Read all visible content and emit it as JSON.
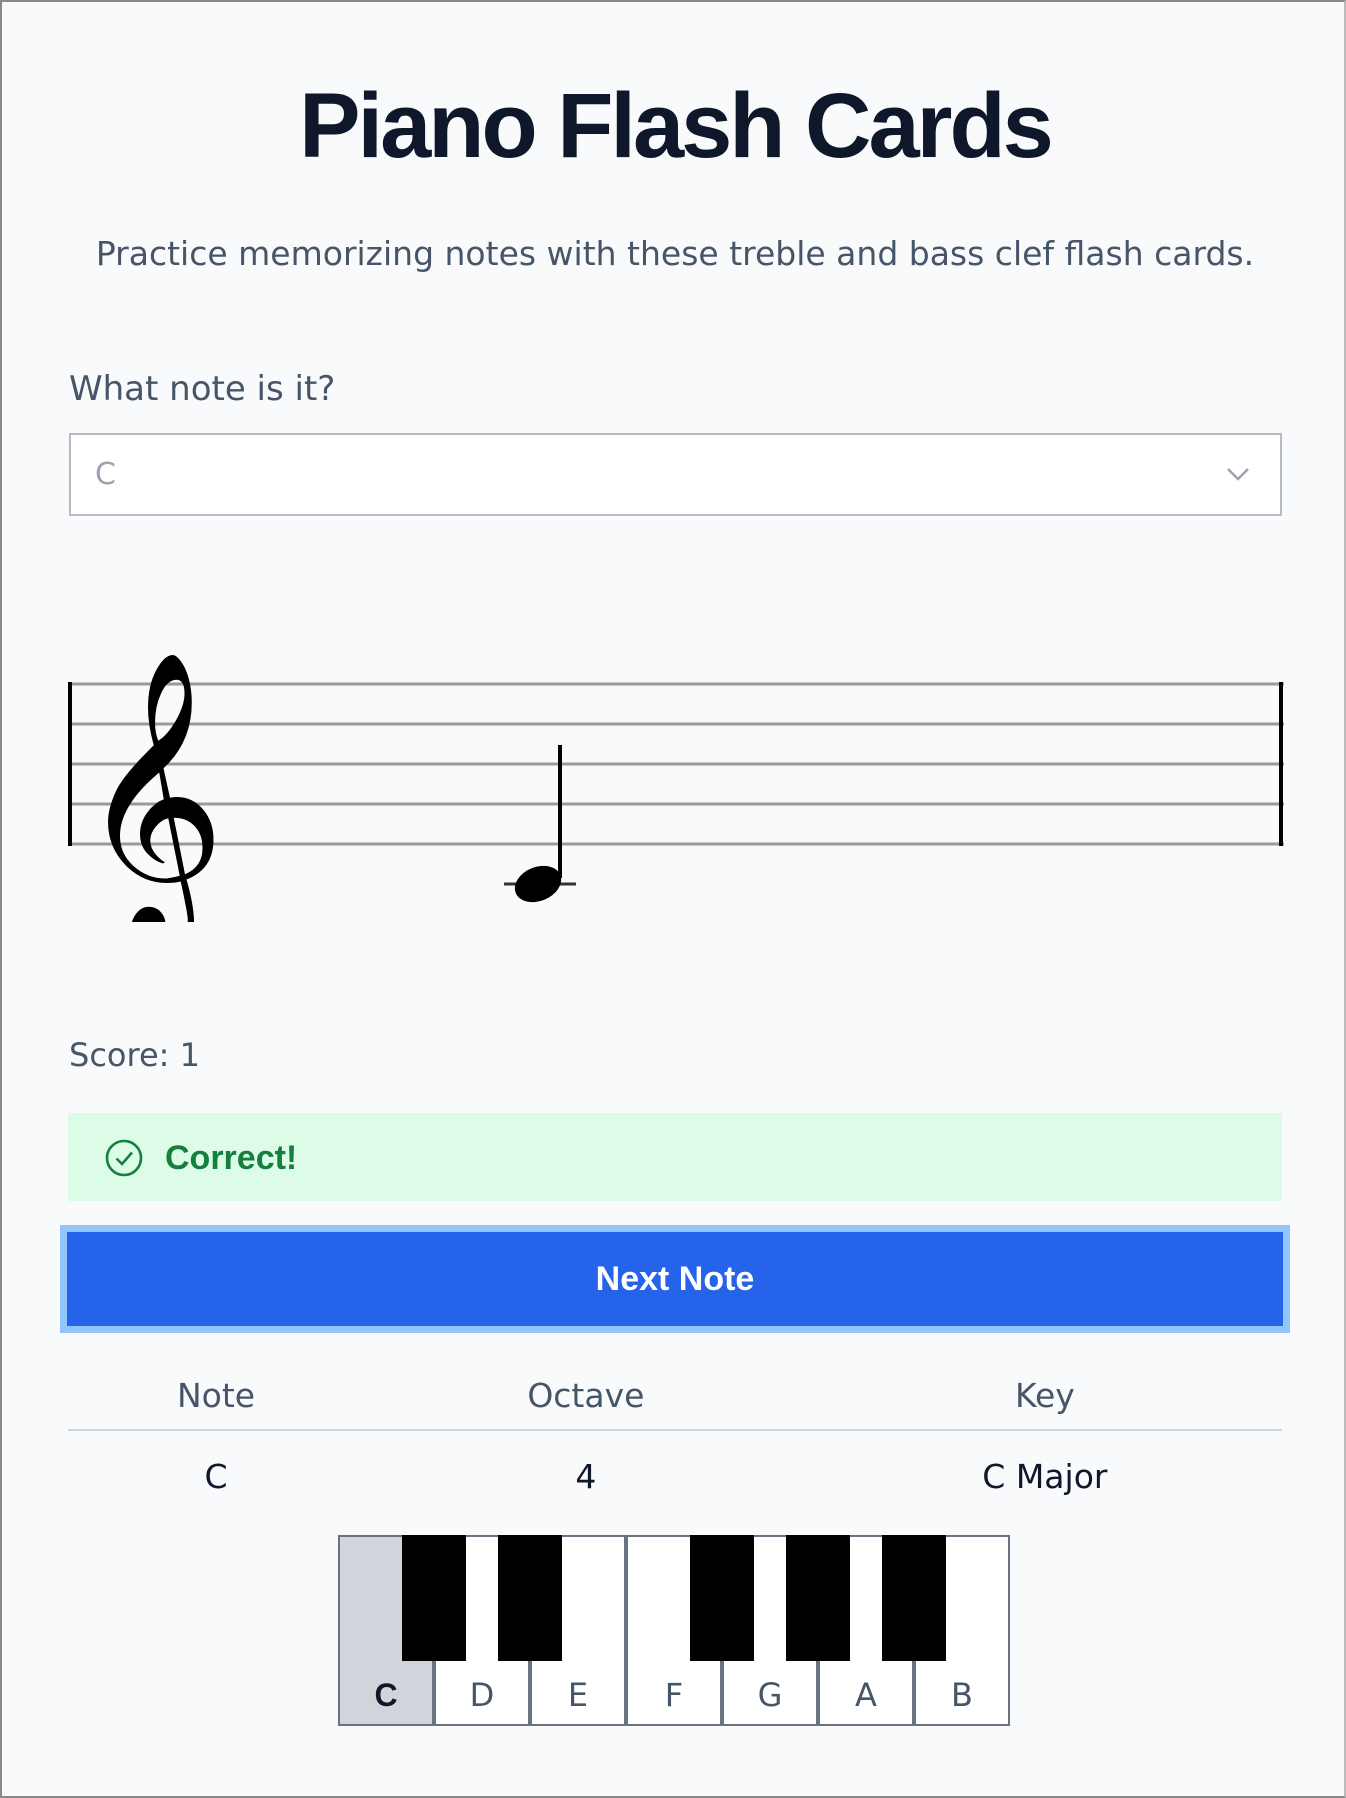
{
  "page": {
    "title": "Piano Flash Cards",
    "subtitle": "Practice memorizing notes with these treble and bass clef flash cards."
  },
  "quiz": {
    "question": "What note is it?",
    "selected_note": "C",
    "score_text": "Score: 1",
    "feedback": "Correct!",
    "next_button_label": "Next Note"
  },
  "staff": {
    "clef": "treble",
    "note": "C",
    "octave": 4,
    "duration": "quarter"
  },
  "info_table": {
    "headers": [
      "Note",
      "Octave",
      "Key"
    ],
    "rows": [
      [
        "C",
        "4",
        "C Major"
      ]
    ]
  },
  "keyboard": {
    "white_keys": [
      "C",
      "D",
      "E",
      "F",
      "G",
      "A",
      "B"
    ],
    "active_key": "C"
  },
  "colors": {
    "primary": "#2563eb",
    "focus_ring": "#93c5fd",
    "success_bg": "#dcfce7",
    "success_text": "#15803d",
    "active_key": "#d1d5db"
  },
  "icons": {
    "select_chevron": "chevron-down-icon",
    "feedback": "check-circle-icon",
    "clef": "treble-clef-icon"
  }
}
